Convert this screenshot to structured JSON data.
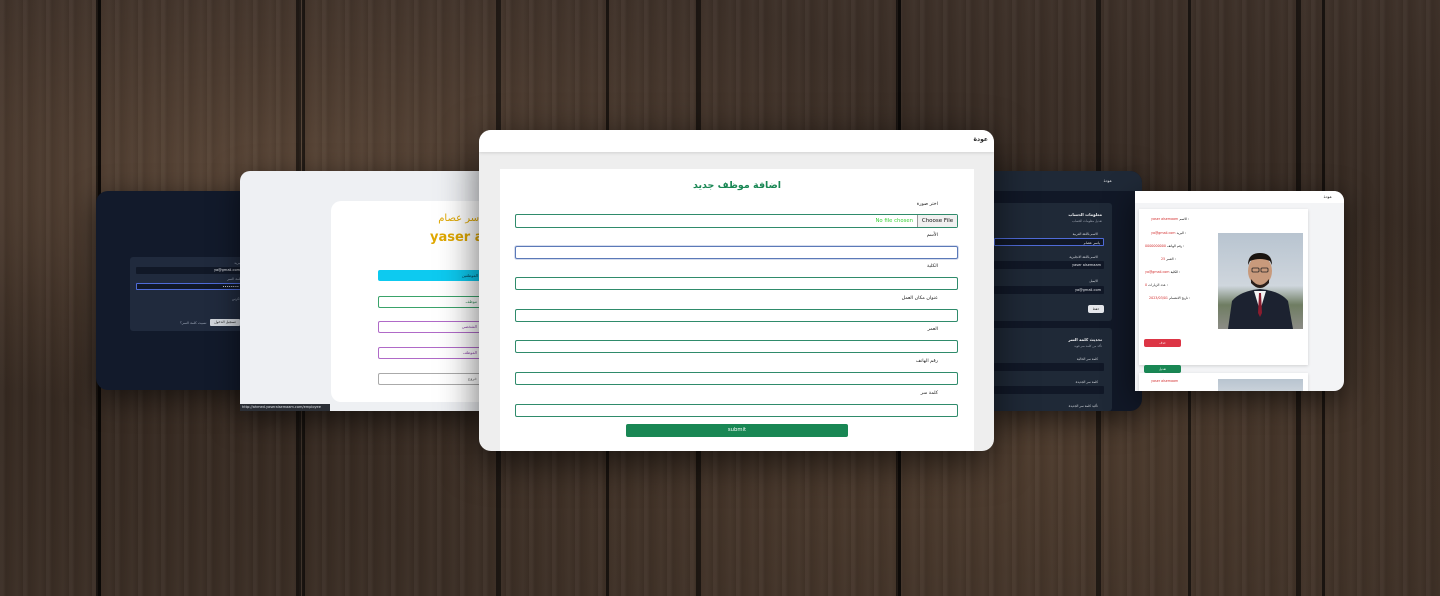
{
  "login_screen": {
    "email_label": "البريد",
    "email_value": "ya@gmail.com",
    "password_label": "كلمة السر",
    "password_value": "••••••••",
    "remember_label": "تذكرني",
    "login_button": "تسجيل الدخول",
    "forgot_link": "نسيت كلمة السر؟"
  },
  "employee_page": {
    "name_ar": "ياسر عصام",
    "name_en": "yaser als",
    "cyan_button": "الموظفين",
    "buttons": [
      "موظف",
      "الشخصي",
      "الموظف",
      "خروج"
    ],
    "url": "http://ahmed.yaseralsemaam.com/employee"
  },
  "main_form": {
    "back": "عودة",
    "title": "اضافة موظف جديد",
    "image_label": "اختر صورة",
    "file_button": "Choose File",
    "file_status": "No file chosen",
    "fields": [
      {
        "label": "الأسم",
        "value": ""
      },
      {
        "label": "الكلية",
        "value": ""
      },
      {
        "label": "عنوان مكان العمل",
        "value": ""
      },
      {
        "label": "العمر",
        "value": ""
      },
      {
        "label": "رقم الهاتف",
        "value": ""
      },
      {
        "label": "كلمة سر",
        "value": ""
      }
    ],
    "submit": "submit"
  },
  "settings_page": {
    "back": "عودة",
    "account_title": "معلومات الحساب",
    "account_sub": "تعديل معلومات الحساب",
    "name_ar_label": "الاسم باللغة العربية",
    "name_ar_value": "ياسر عصام",
    "name_en_label": "الاسم باللغة الانجليزية",
    "name_en_value": "yaser alsemaam",
    "email_label": "الايميل",
    "email_value": "ya@gmail.com",
    "save_button": "حفظ",
    "password_title": "تحديث كلمة السر",
    "password_sub": "تأكد من كلمة سر قوية",
    "current_label": "كلمة سر الحالية",
    "new_label": "كلمة سر الجديدة",
    "confirm_label": "تأكيد كلمة سر الجديدة"
  },
  "profile_page": {
    "back": "عودة",
    "rows": [
      {
        "label": "الاسم :",
        "value": "yaser alsemaam"
      },
      {
        "label": "البريد :",
        "value": "ya@gmail.com"
      },
      {
        "label": "رقم الهاتف :",
        "value": "0000000000"
      },
      {
        "label": "العمر :",
        "value": "25"
      },
      {
        "label": "الكلية :",
        "value": "ya@gmail.com"
      },
      {
        "label": "عدد الزيارات :",
        "value": "0"
      },
      {
        "label": "تاريخ الانضمام :",
        "value": "2023/03/01"
      }
    ],
    "delete_button": "حذف",
    "edit_button": "تعديل",
    "second_card_name": "yaser alsemaam"
  }
}
